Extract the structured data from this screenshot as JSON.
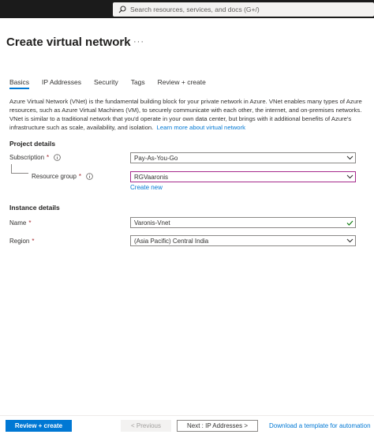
{
  "topbar": {
    "search_placeholder": "Search resources, services, and docs (G+/)"
  },
  "page": {
    "title": "Create virtual network",
    "more": "···"
  },
  "tabs": [
    {
      "label": "Basics",
      "active": true
    },
    {
      "label": "IP Addresses",
      "active": false
    },
    {
      "label": "Security",
      "active": false
    },
    {
      "label": "Tags",
      "active": false
    },
    {
      "label": "Review + create",
      "active": false
    }
  ],
  "description": {
    "text": "Azure Virtual Network (VNet) is the fundamental building block for your private network in Azure. VNet enables many types of Azure resources, such as Azure Virtual Machines (VM), to securely communicate with each other, the internet, and on-premises networks. VNet is similar to a traditional network that you'd operate in your own data center, but brings with it additional benefits of Azure's infrastructure such as scale, availability, and isolation.",
    "link": "Learn more about virtual network"
  },
  "project_details": {
    "heading": "Project details",
    "subscription": {
      "label": "Subscription",
      "required": "*",
      "value": "Pay-As-You-Go"
    },
    "resource_group": {
      "label": "Resource group",
      "required": "*",
      "value": "RGVaaronis",
      "create_new": "Create new"
    }
  },
  "instance_details": {
    "heading": "Instance details",
    "name": {
      "label": "Name",
      "required": "*",
      "value": "Varonis-Vnet"
    },
    "region": {
      "label": "Region",
      "required": "*",
      "value": "(Asia Pacific) Central India"
    }
  },
  "footer": {
    "review_create": "Review + create",
    "previous": "< Previous",
    "next": "Next : IP Addresses >",
    "download": "Download a template for automation"
  },
  "colors": {
    "accent": "#0078d4",
    "required": "#a4262c",
    "focus_border": "#a62b8c",
    "valid_check": "#107c10",
    "topbar": "#1b1b1b"
  }
}
